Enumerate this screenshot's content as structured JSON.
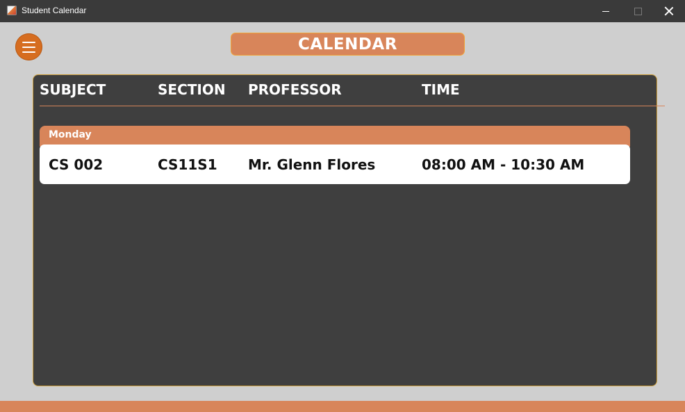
{
  "window": {
    "title": "Student Calendar"
  },
  "header": {
    "title": "CALENDAR",
    "menu_icon": "hamburger-menu-icon"
  },
  "table": {
    "columns": [
      "SUBJECT",
      "SECTION",
      "PROFESSOR",
      "TIME"
    ],
    "days": [
      {
        "day": "Monday",
        "entries": [
          {
            "subject": "CS 002",
            "section": "CS11S1",
            "professor": "Mr. Glenn Flores",
            "time": "08:00 AM - 10:30 AM"
          }
        ]
      }
    ]
  },
  "colors": {
    "accent": "#d8855a",
    "menu_button": "#d66d20",
    "panel": "#3f3f3f",
    "background": "#cfcfcf",
    "titlebar": "#3a3a3a"
  }
}
